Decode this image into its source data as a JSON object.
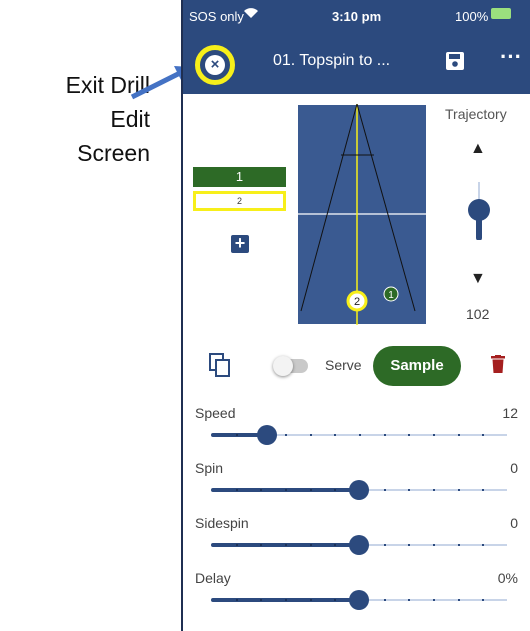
{
  "annotation": {
    "lines": [
      "Exit Drill",
      "Edit",
      "Screen"
    ]
  },
  "status_bar": {
    "carrier": "SOS only",
    "time": "3:10 pm",
    "battery": "100%"
  },
  "app_bar": {
    "title": "01. Topspin to ...",
    "close_icon": "close-circle-icon",
    "save_icon": "save-icon",
    "more_icon": "more-horizontal-icon"
  },
  "balls": [
    {
      "label": "1",
      "selected": true
    },
    {
      "label": "2",
      "selected": false
    }
  ],
  "court": {
    "markers": [
      {
        "label": "2",
        "color": "#f7ef1a"
      },
      {
        "label": "1",
        "color": "#2d6a26"
      }
    ]
  },
  "trajectory": {
    "label": "Trajectory",
    "value": "102",
    "level": 0.5
  },
  "controls": {
    "serve_label": "Serve",
    "serve_on": false,
    "sample_label": "Sample"
  },
  "parameters": [
    {
      "name": "Speed",
      "value": "12",
      "fraction": 0.19
    },
    {
      "name": "Spin",
      "value": "0",
      "fraction": 0.5
    },
    {
      "name": "Sidespin",
      "value": "0",
      "fraction": 0.5
    },
    {
      "name": "Delay",
      "value": "0%",
      "fraction": 0.5
    }
  ],
  "colors": {
    "primary": "#2c4a7e",
    "accent_green": "#2d6a26",
    "highlight_yellow": "#f7ef1a",
    "court_blue": "#3a5a91",
    "delete_red": "#a51f1f"
  }
}
